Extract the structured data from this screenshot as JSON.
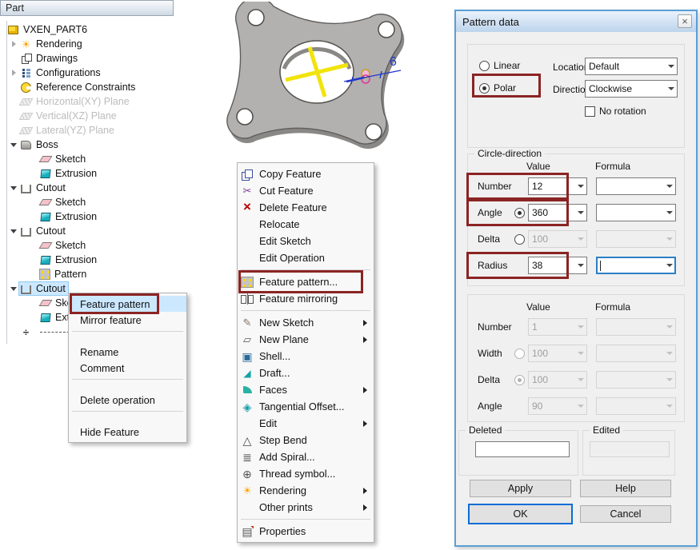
{
  "colors": {
    "highlight_box": "#8b2424",
    "selection_fill": "#cce8ff",
    "dialog_border": "#5b9fd4",
    "focus_blue": "#0a6cd6"
  },
  "part_tree": {
    "title": "Part",
    "items": [
      {
        "level": 0,
        "root": true,
        "icon": "part",
        "label": "VXEN_PART6"
      },
      {
        "level": 1,
        "chev_collapsed": true,
        "icon": "sun",
        "label": "Rendering"
      },
      {
        "level": 1,
        "icon": "drawings",
        "label": "Drawings"
      },
      {
        "level": 1,
        "chev_collapsed": true,
        "icon": "configurations",
        "label": "Configurations"
      },
      {
        "level": 1,
        "icon": "constraints",
        "label": "Reference Constraints"
      },
      {
        "level": 1,
        "icon": "plane",
        "label": "Horizontal(XY) Plane",
        "disabled": true
      },
      {
        "level": 1,
        "icon": "plane",
        "label": "Vertical(XZ) Plane",
        "disabled": true
      },
      {
        "level": 1,
        "icon": "plane",
        "label": "Lateral(YZ) Plane",
        "disabled": true
      },
      {
        "level": 1,
        "chev_expanded": true,
        "icon": "boss",
        "label": "Boss"
      },
      {
        "level": 2,
        "icon": "sketch",
        "label": "Sketch"
      },
      {
        "level": 2,
        "icon": "extrusion",
        "label": "Extrusion"
      },
      {
        "level": 1,
        "chev_expanded": true,
        "icon": "cutout",
        "label": "Cutout"
      },
      {
        "level": 2,
        "icon": "sketch",
        "label": "Sketch"
      },
      {
        "level": 2,
        "icon": "extrusion",
        "label": "Extrusion"
      },
      {
        "level": 1,
        "chev_expanded": true,
        "icon": "cutout",
        "label": "Cutout"
      },
      {
        "level": 2,
        "icon": "sketch",
        "label": "Sketch"
      },
      {
        "level": 2,
        "icon": "extrusion",
        "label": "Extrusion"
      },
      {
        "level": 2,
        "icon": "pattern",
        "label": "Pattern"
      },
      {
        "level": 1,
        "chev_expanded": true,
        "icon": "cutout",
        "label": "Cutout",
        "selected": true
      },
      {
        "level": 2,
        "icon": "sketch",
        "label": "Sketch"
      },
      {
        "level": 2,
        "icon": "extrusion",
        "label": "Extrusion"
      },
      {
        "level": 1,
        "icon": "rollback",
        "label": "",
        "rollback": true
      }
    ]
  },
  "tree_context_menu": {
    "items": [
      {
        "label": "Feature pattern",
        "highlighted": true,
        "boxed": true
      },
      {
        "label": "Mirror feature"
      },
      {
        "separator": true
      },
      {
        "label": "Rename"
      },
      {
        "label": "Comment"
      },
      {
        "separator": true
      },
      {
        "label": "Delete operation"
      },
      {
        "separator": true
      },
      {
        "label": "Hide Feature"
      }
    ]
  },
  "feature_context_menu": {
    "items": [
      {
        "icon": "copy",
        "label": "Copy Feature"
      },
      {
        "icon": "cut",
        "label": "Cut Feature"
      },
      {
        "icon": "delete",
        "label": "Delete Feature"
      },
      {
        "label": "Relocate"
      },
      {
        "label": "Edit Sketch"
      },
      {
        "label": "Edit Operation"
      },
      {
        "separator": true
      },
      {
        "icon": "pattern",
        "label": "Feature pattern...",
        "boxed": true
      },
      {
        "icon": "mirror",
        "label": "Feature mirroring"
      },
      {
        "separator": true
      },
      {
        "icon": "new-sketch",
        "label": "New Sketch",
        "submenu": true
      },
      {
        "icon": "new-plane",
        "label": "New Plane",
        "submenu": true
      },
      {
        "icon": "shell",
        "label": "Shell..."
      },
      {
        "icon": "draft",
        "label": "Draft..."
      },
      {
        "icon": "faces",
        "label": "Faces",
        "submenu": true
      },
      {
        "icon": "tangential",
        "label": "Tangential Offset..."
      },
      {
        "label": "Edit",
        "submenu": true
      },
      {
        "icon": "step-bend",
        "label": "Step Bend"
      },
      {
        "icon": "spiral",
        "label": "Add Spiral..."
      },
      {
        "icon": "thread",
        "label": "Thread symbol..."
      },
      {
        "icon": "sun",
        "label": "Rendering",
        "submenu": true
      },
      {
        "label": "Other prints",
        "submenu": true
      },
      {
        "separator": true
      },
      {
        "icon": "properties",
        "label": "Properties"
      }
    ]
  },
  "viewport": {
    "dimension_label": "6"
  },
  "dialog": {
    "title": "Pattern data",
    "close_label": "×",
    "type_options": [
      {
        "label": "Linear"
      },
      {
        "label": "Polar",
        "checked": true,
        "boxed": true
      }
    ],
    "location_label": "Location",
    "location_value": "Default",
    "direction_label": "Direction",
    "direction_value": "Clockwise",
    "no_rotation_label": "No rotation",
    "circle_direction": {
      "title": "Circle-direction",
      "value_header": "Value",
      "formula_header": "Formula",
      "rows": [
        {
          "label": "Number",
          "value": "12",
          "boxed": true
        },
        {
          "label": "Angle",
          "has_radio": true,
          "radio_checked": true,
          "value": "360",
          "boxed": true
        },
        {
          "label": "Delta",
          "has_radio": true,
          "value": "100",
          "disabled": true
        },
        {
          "label": "Radius",
          "value": "38",
          "boxed": true,
          "formula_focused": true
        }
      ]
    },
    "second_direction": {
      "value_header": "Value",
      "formula_header": "Formula",
      "rows": [
        {
          "label": "Number",
          "value": "1",
          "disabled": true
        },
        {
          "label": "Width",
          "has_radio": true,
          "value": "100",
          "disabled": true
        },
        {
          "label": "Delta",
          "has_radio": true,
          "radio_checked": true,
          "value": "100",
          "disabled": true
        },
        {
          "label": "Angle",
          "value": "90",
          "disabled": true
        }
      ]
    },
    "deleted_group": {
      "title": "Deleted",
      "value": ""
    },
    "edited_group": {
      "title": "Edited",
      "value": ""
    },
    "buttons": {
      "apply": "Apply",
      "help": "Help",
      "ok": "OK",
      "cancel": "Cancel"
    }
  }
}
